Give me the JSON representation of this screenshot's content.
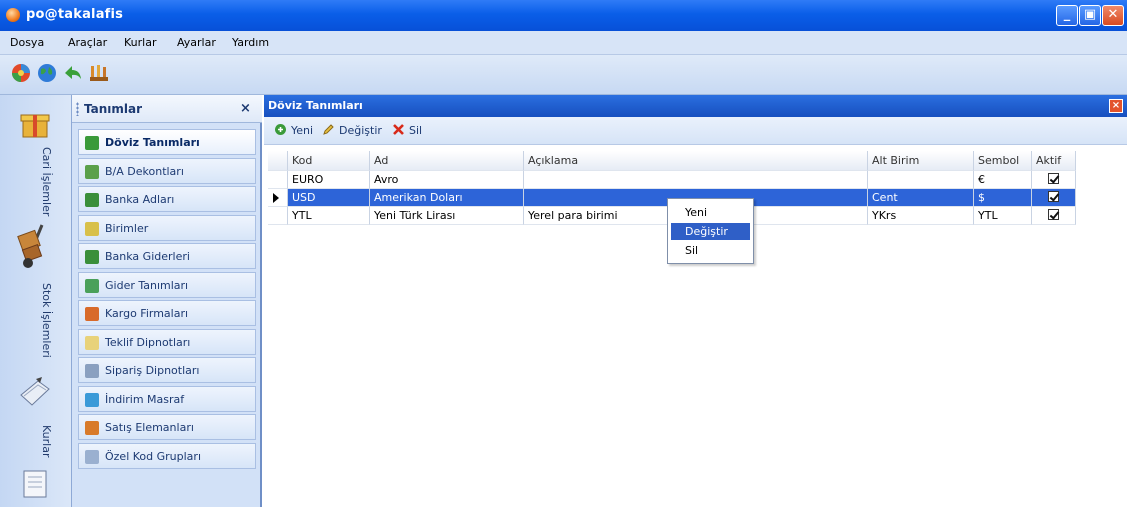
{
  "window": {
    "title": "po@takalafis"
  },
  "menubar": [
    "Dosya",
    "Araçlar",
    "Kurlar",
    "Ayarlar",
    "Yardım"
  ],
  "toolbar_icons": [
    "colorful-ball-icon",
    "globe-icon",
    "green-arrow-back-icon",
    "toolbox-icon"
  ],
  "left_strip": [
    {
      "label": "Cari İşlemler",
      "icon": "gift-box-icon"
    },
    {
      "label": "Stok İşlemleri",
      "icon": "hand-truck-icon"
    },
    {
      "label": "Kurlar",
      "icon": "book-pen-icon"
    },
    {
      "label": "",
      "icon": "notebook-icon"
    }
  ],
  "tanimlar": {
    "title": "Tanımlar",
    "close": "×",
    "items": [
      {
        "label": "Döviz Tanımları",
        "icon": "currency-icon",
        "color": "#3a9a3a",
        "selected": true
      },
      {
        "label": "B/A Dekontları",
        "icon": "voucher-icon",
        "color": "#5aa04a"
      },
      {
        "label": "Banka Adları",
        "icon": "bank-icon",
        "color": "#3a8f3a"
      },
      {
        "label": "Birimler",
        "icon": "unit-icon",
        "color": "#d8c04a"
      },
      {
        "label": "Banka Giderleri",
        "icon": "bank-expense-icon",
        "color": "#3a8f3a"
      },
      {
        "label": "Gider Tanımları",
        "icon": "expense-icon",
        "color": "#4aa05a"
      },
      {
        "label": "Kargo Firmaları",
        "icon": "cargo-icon",
        "color": "#d86a2a"
      },
      {
        "label": "Teklif Dipnotları",
        "icon": "note-icon",
        "color": "#e8d27a"
      },
      {
        "label": "Sipariş Dipnotları",
        "icon": "order-note-icon",
        "color": "#8aa0c0"
      },
      {
        "label": "İndirim Masraf",
        "icon": "discount-icon",
        "color": "#3a9ad8"
      },
      {
        "label": "Satış Elemanları",
        "icon": "sales-staff-icon",
        "color": "#d87a2a"
      },
      {
        "label": "Özel Kod Grupları",
        "icon": "code-group-icon",
        "color": "#9ab0d0"
      }
    ]
  },
  "content": {
    "title": "Döviz Tanımları",
    "close": "×",
    "toolbar": [
      {
        "label": "Yeni",
        "icon": "new-icon",
        "color": "#3a9a3a"
      },
      {
        "label": "Değiştir",
        "icon": "edit-icon",
        "color": "#e8c040"
      },
      {
        "label": "Sil",
        "icon": "delete-icon",
        "color": "#d82a1a"
      }
    ],
    "columns": [
      "Kod",
      "Ad",
      "Açıklama",
      "Alt Birim",
      "Sembol",
      "Aktif"
    ],
    "rows": [
      {
        "kod": "EURO",
        "ad": "Avro",
        "aciklama": "",
        "alt_birim": "",
        "sembol": "€",
        "aktif": true
      },
      {
        "kod": "USD",
        "ad": "Amerikan Doları",
        "aciklama": "",
        "alt_birim": "Cent",
        "sembol": "$",
        "aktif": true
      },
      {
        "kod": "YTL",
        "ad": "Yeni Türk Lirası",
        "aciklama": "Yerel para birimi",
        "alt_birim": "YKrs",
        "sembol": "YTL",
        "aktif": true
      }
    ]
  },
  "context_menu": [
    "Yeni",
    "Değiştir",
    "Sil"
  ]
}
